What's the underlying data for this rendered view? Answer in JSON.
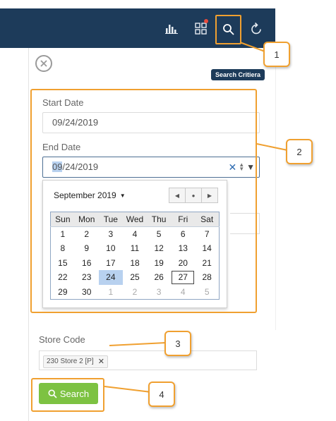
{
  "toolbar": {
    "icons": [
      "bar-chart-icon",
      "grid-icon",
      "search-icon",
      "refresh-icon"
    ],
    "search_tooltip": "Search Critiera"
  },
  "filters": {
    "start_date_label": "Start Date",
    "start_date_value": "09/24/2019",
    "end_date_label": "End Date",
    "end_date_selected": "09",
    "end_date_rest": "/24/2019"
  },
  "calendar": {
    "month_label": "September 2019",
    "weekdays": [
      "Sun",
      "Mon",
      "Tue",
      "Wed",
      "Thu",
      "Fri",
      "Sat"
    ],
    "weeks": [
      [
        "1",
        "2",
        "3",
        "4",
        "5",
        "6",
        "7"
      ],
      [
        "8",
        "9",
        "10",
        "11",
        "12",
        "13",
        "14"
      ],
      [
        "15",
        "16",
        "17",
        "18",
        "19",
        "20",
        "21"
      ],
      [
        "22",
        "23",
        "24",
        "25",
        "26",
        "27",
        "28"
      ],
      [
        "29",
        "30",
        "1",
        "2",
        "3",
        "4",
        "5"
      ]
    ],
    "selected_day": "24",
    "today_day": "27"
  },
  "store": {
    "label": "Store Code",
    "tag": "230 Store 2 [P]"
  },
  "search_button_label": "Search",
  "callouts": [
    "1",
    "2",
    "3",
    "4"
  ],
  "colors": {
    "header": "#1d3b5a",
    "accent_orange": "#f0a030",
    "search_green": "#7dc242",
    "selection": "#b8d1ef"
  }
}
